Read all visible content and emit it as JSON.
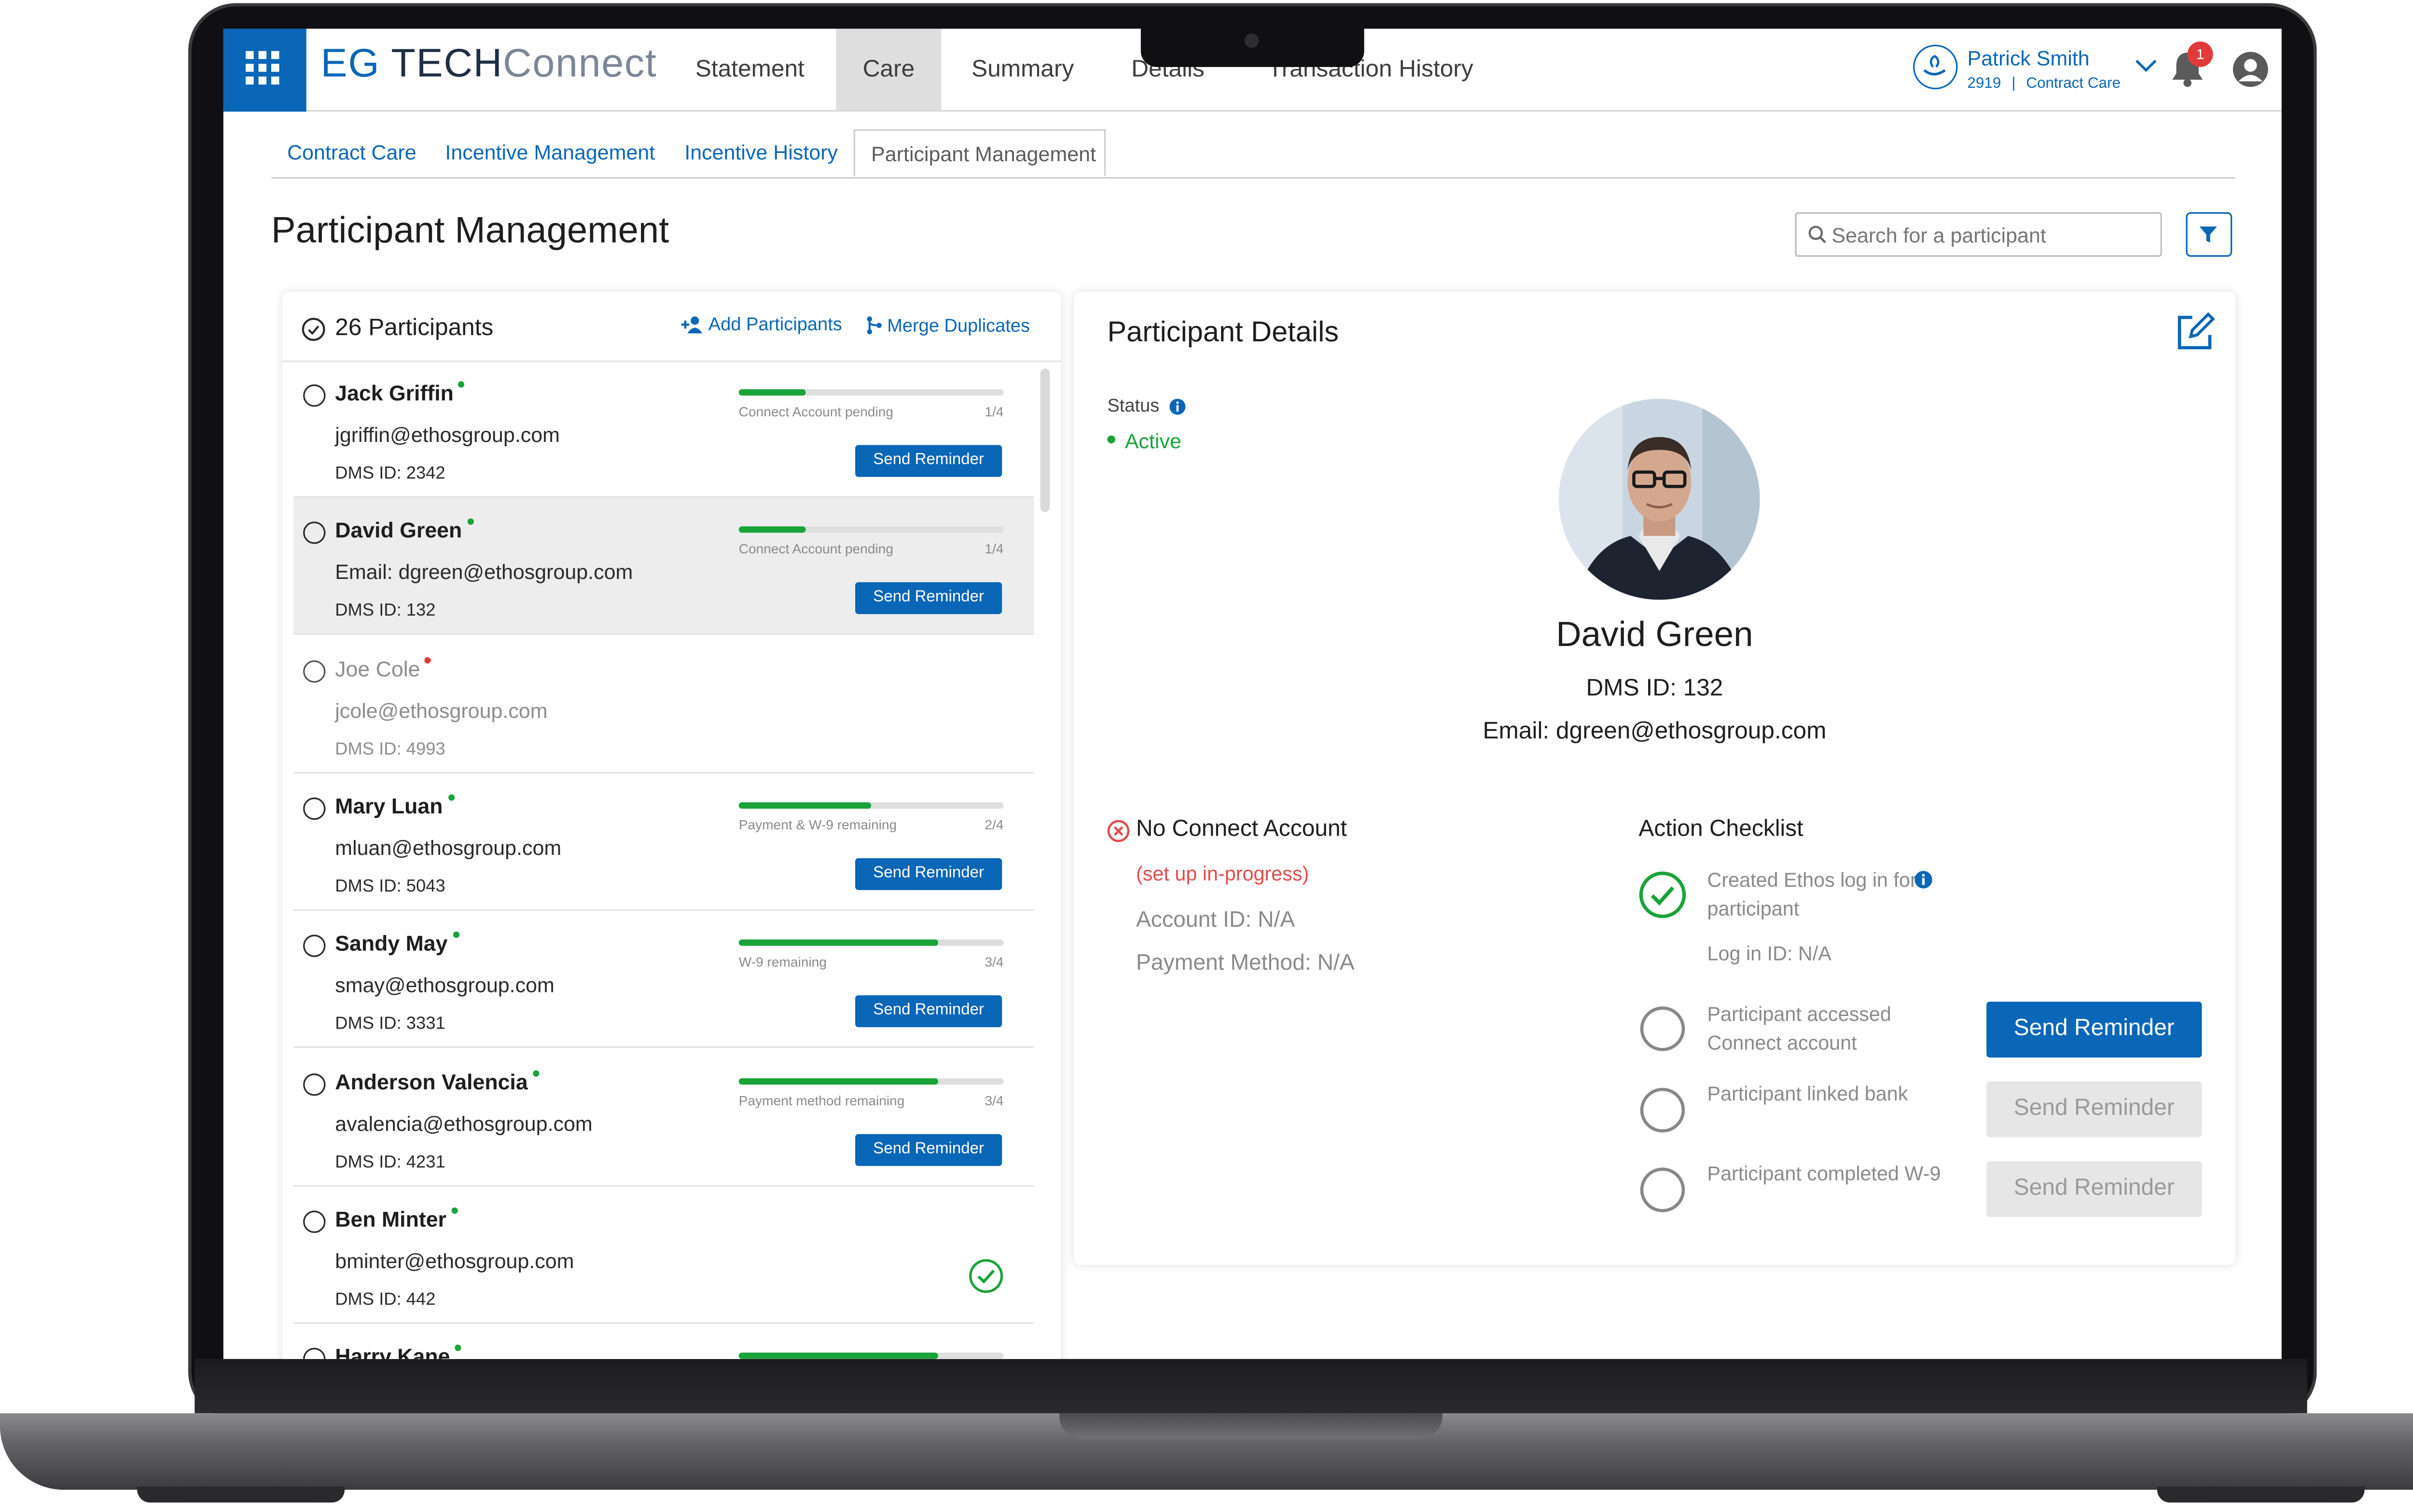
{
  "app": {
    "brand_eg": "EG",
    "brand_tech": "TECH",
    "brand_connect": "Connect",
    "nav": [
      {
        "label": "Statement"
      },
      {
        "label": "Care"
      },
      {
        "label": "Summary"
      },
      {
        "label": "Details"
      },
      {
        "label": "Transaction History"
      }
    ],
    "active_nav": "Care",
    "user_name": "Patrick Smith",
    "user_id": "2919",
    "user_role": "Contract Care",
    "notification_count": "1"
  },
  "subtabs": [
    {
      "label": "Contract Care"
    },
    {
      "label": "Incentive Management"
    },
    {
      "label": "Incentive History"
    },
    {
      "label": "Participant Management"
    }
  ],
  "page": {
    "title": "Participant Management",
    "search_placeholder": "Search for a participant"
  },
  "list": {
    "count_label": "26 Participants",
    "add_label": "Add Participants",
    "merge_label": "Merge Duplicates",
    "send_label": "Send Reminder",
    "participants": [
      {
        "name": "Jack Griffin",
        "email": "jgriffin@ethosgroup.com",
        "dms": "DMS ID: 2342",
        "status": "Connect Account pending",
        "step": "1/4",
        "progress": 0.25,
        "dot": "#1aa33a",
        "state": "progress"
      },
      {
        "name": "David Green",
        "email": "Email: dgreen@ethosgroup.com",
        "dms": "DMS ID: 132",
        "status": "Connect Account pending",
        "step": "1/4",
        "progress": 0.25,
        "dot": "#1aa33a",
        "state": "progress"
      },
      {
        "name": "Joe Cole",
        "email": "jcole@ethosgroup.com",
        "dms": "DMS ID: 4993",
        "status": "",
        "step": "",
        "progress": 0,
        "dot": "#e23a3a",
        "state": "inactive"
      },
      {
        "name": "Mary Luan",
        "email": "mluan@ethosgroup.com",
        "dms": "DMS ID: 5043",
        "status": "Payment & W-9 remaining",
        "step": "2/4",
        "progress": 0.5,
        "dot": "#1aa33a",
        "state": "progress"
      },
      {
        "name": "Sandy May",
        "email": "smay@ethosgroup.com",
        "dms": "DMS ID: 3331",
        "status": "W-9 remaining",
        "step": "3/4",
        "progress": 0.75,
        "dot": "#1aa33a",
        "state": "progress"
      },
      {
        "name": "Anderson Valencia",
        "email": "avalencia@ethosgroup.com",
        "dms": "DMS ID: 4231",
        "status": "Payment method remaining",
        "step": "3/4",
        "progress": 0.75,
        "dot": "#1aa33a",
        "state": "progress"
      },
      {
        "name": "Ben Minter",
        "email": "bminter@ethosgroup.com",
        "dms": "DMS ID: 442",
        "status": "",
        "step": "",
        "progress": 1,
        "dot": "#1aa33a",
        "state": "complete"
      },
      {
        "name": "Harry Kane",
        "email": "",
        "dms": "",
        "status": "",
        "step": "",
        "progress": 0.75,
        "dot": "#1aa33a",
        "state": "progress"
      }
    ]
  },
  "details": {
    "title": "Participant Details",
    "status_label": "Status",
    "status_value": "Active",
    "name": "David Green",
    "dms": "DMS ID: 132",
    "email": "Email: dgreen@ethosgroup.com",
    "no_account": "No Connect Account",
    "setup_note": "(set up in-progress)",
    "account_id": "Account ID: N/A",
    "payment_method": "Payment Method: N/A",
    "checklist_title": "Action Checklist",
    "checklist": [
      {
        "label": "Created Ethos log in for participant",
        "done": true,
        "sub": "Log in ID: N/A",
        "button": ""
      },
      {
        "label": "Participant accessed Connect account",
        "done": false,
        "sub": "",
        "button": "Send Reminder",
        "button_enabled": true
      },
      {
        "label": "Participant linked bank",
        "done": false,
        "sub": "",
        "button": "Send Reminder",
        "button_enabled": false
      },
      {
        "label": "Participant completed W-9",
        "done": false,
        "sub": "",
        "button": "Send Reminder",
        "button_enabled": false
      }
    ]
  },
  "colors": {
    "brand_blue": "#0a66b7",
    "success_green": "#1aa33a",
    "error_red": "#e24b4b"
  }
}
